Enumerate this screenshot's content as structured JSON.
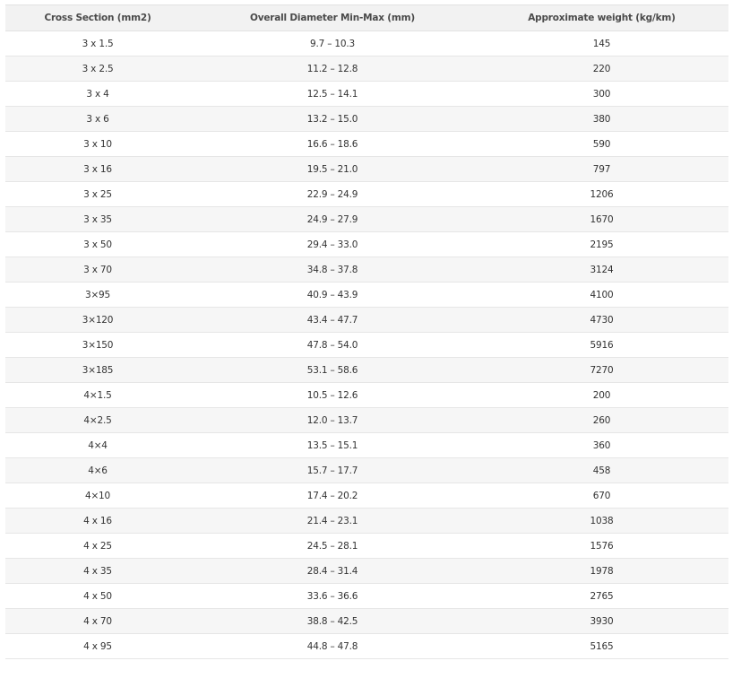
{
  "table": {
    "headers": [
      "Cross Section (mm2)",
      "Overall Diameter Min-Max (mm)",
      "Approximate weight (kg/km)"
    ],
    "rows": [
      [
        "3 x 1.5",
        "9.7 – 10.3",
        "145"
      ],
      [
        "3 x 2.5",
        "11.2 – 12.8",
        "220"
      ],
      [
        "3 x 4",
        "12.5 – 14.1",
        "300"
      ],
      [
        "3 x 6",
        "13.2 – 15.0",
        "380"
      ],
      [
        "3 x 10",
        "16.6 – 18.6",
        "590"
      ],
      [
        "3 x 16",
        "19.5 – 21.0",
        "797"
      ],
      [
        "3 x 25",
        "22.9 – 24.9",
        "1206"
      ],
      [
        "3 x 35",
        "24.9 – 27.9",
        "1670"
      ],
      [
        "3 x 50",
        "29.4 – 33.0",
        "2195"
      ],
      [
        "3 x 70",
        "34.8 – 37.8",
        "3124"
      ],
      [
        "3×95",
        "40.9 – 43.9",
        "4100"
      ],
      [
        "3×120",
        "43.4 – 47.7",
        "4730"
      ],
      [
        "3×150",
        "47.8 – 54.0",
        "5916"
      ],
      [
        "3×185",
        "53.1 – 58.6",
        "7270"
      ],
      [
        "4×1.5",
        "10.5 – 12.6",
        "200"
      ],
      [
        "4×2.5",
        "12.0 – 13.7",
        "260"
      ],
      [
        "4×4",
        "13.5 – 15.1",
        "360"
      ],
      [
        "4×6",
        "15.7 – 17.7",
        "458"
      ],
      [
        "4×10",
        "17.4 – 20.2",
        "670"
      ],
      [
        "4 x 16",
        "21.4 – 23.1",
        "1038"
      ],
      [
        "4 x 25",
        "24.5 – 28.1",
        "1576"
      ],
      [
        "4 x 35",
        "28.4 – 31.4",
        "1978"
      ],
      [
        "4 x 50",
        "33.6 – 36.6",
        "2765"
      ],
      [
        "4 x 70",
        "38.8 – 42.5",
        "3930"
      ],
      [
        "4 x 95",
        "44.8 – 47.8",
        "5165"
      ]
    ]
  }
}
